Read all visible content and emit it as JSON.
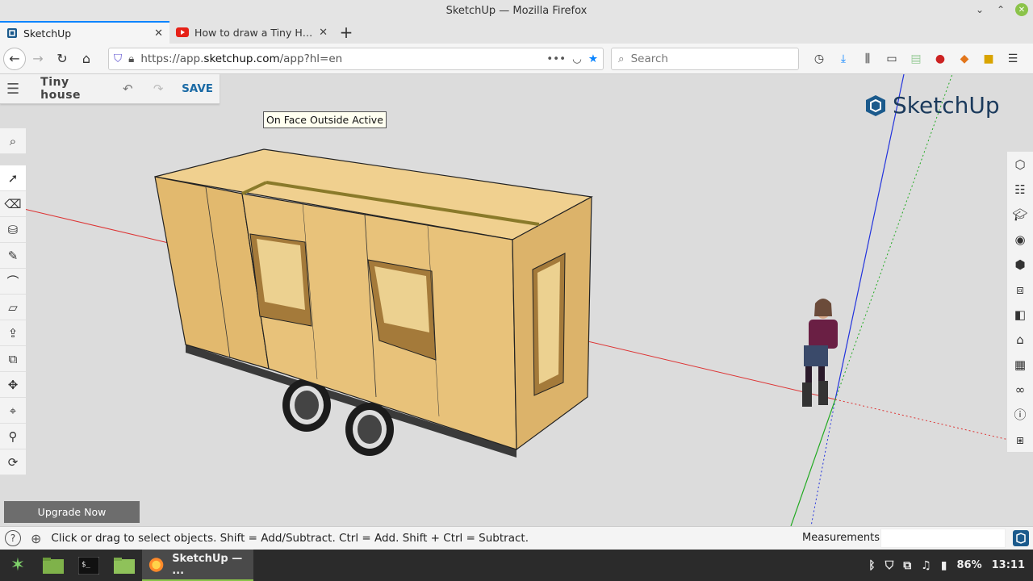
{
  "window": {
    "title": "SketchUp — Mozilla Firefox"
  },
  "tabs": [
    {
      "label": "SketchUp",
      "active": true
    },
    {
      "label": "How to draw a Tiny House",
      "active": false
    }
  ],
  "nav": {
    "url_prefix": "https://app.",
    "url_domain": "sketchup.com",
    "url_path": "/app?hl=en",
    "search_placeholder": "Search",
    "more_icon": "•••"
  },
  "app": {
    "doc_title": "Tiny house",
    "save_label": "SAVE",
    "tooltip": "On Face Outside Active",
    "logo_text": "SketchUp",
    "upgrade_label": "Upgrade Now"
  },
  "status": {
    "hint": "Click or drag to select objects. Shift = Add/Subtract. Ctrl = Add. Shift + Ctrl = Subtract.",
    "measurements_label": "Measurements",
    "help_icon": "?"
  },
  "taskbar": {
    "window_label": "SketchUp — ...",
    "battery": "86%",
    "time": "13:11"
  },
  "colors": {
    "accent": "#0a84ff",
    "wood": "#e8c27a",
    "sketchup_blue": "#1b5a8c"
  }
}
